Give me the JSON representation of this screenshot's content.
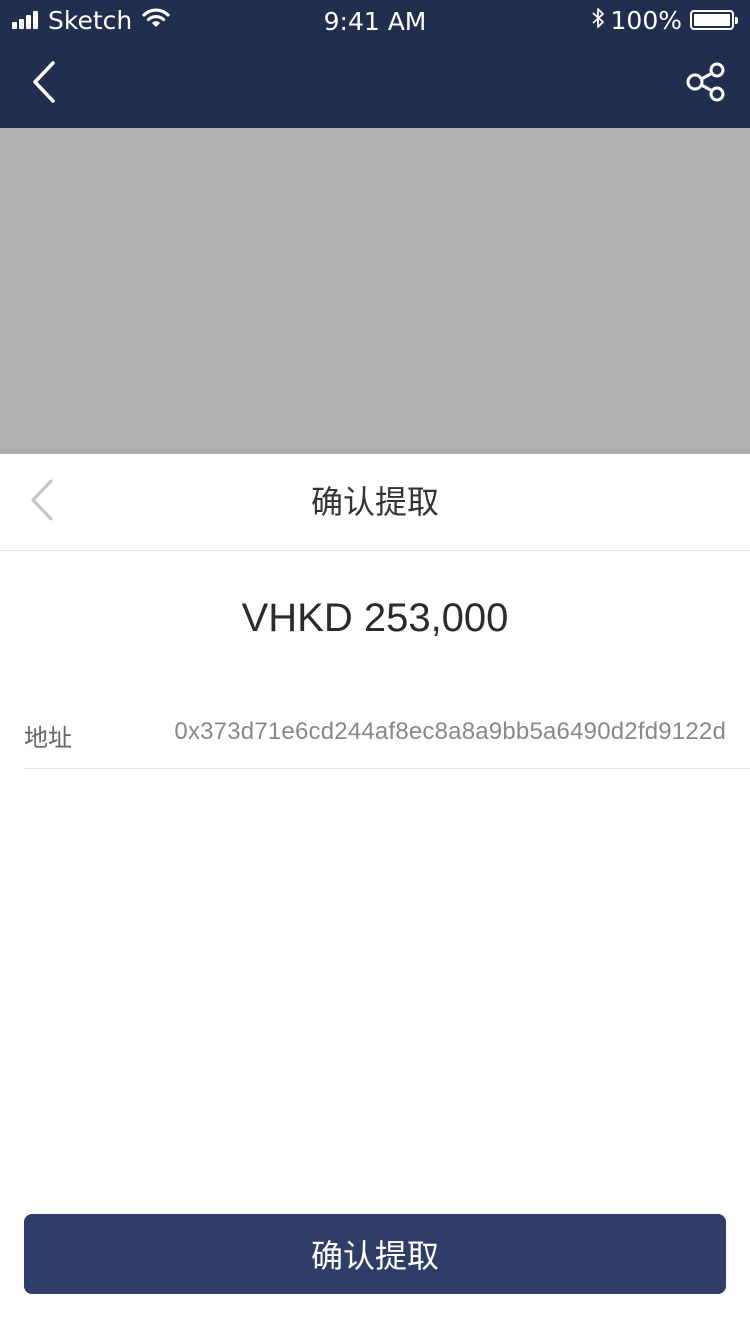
{
  "status_bar": {
    "carrier": "Sketch",
    "time": "9:41 AM",
    "battery_percent": "100%",
    "battery_level": 1.0,
    "signal_icon": "signal-bars-icon",
    "wifi_icon": "wifi-icon",
    "bluetooth_icon": "bluetooth-icon"
  },
  "nav_bar": {
    "back_icon": "chevron-left-icon",
    "share_icon": "share-icon",
    "background_color": "#212e4d"
  },
  "overlay": {
    "color": "#afafaf"
  },
  "sheet": {
    "back_icon": "chevron-left-icon",
    "title": "确认提取",
    "amount": "VHKD 253,000",
    "address_label": "地址",
    "address_value": "0x373d71e6cd244af8ec8a8a9bb5a6490d2fd9122d",
    "confirm_label": "确认提取",
    "button_color": "#2f3d68"
  }
}
